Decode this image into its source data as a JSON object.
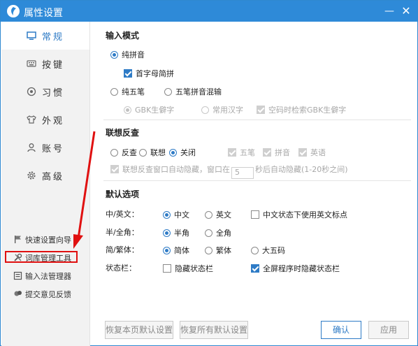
{
  "window": {
    "title": "属性设置",
    "minimize_glyph": "—",
    "close_glyph": "✕"
  },
  "sidebar": {
    "items": [
      {
        "label": "常规",
        "icon": "monitor-icon",
        "active": true
      },
      {
        "label": "按键",
        "icon": "keyboard-icon",
        "active": false
      },
      {
        "label": "习惯",
        "icon": "habit-icon",
        "active": false
      },
      {
        "label": "外观",
        "icon": "shirt-icon",
        "active": false
      },
      {
        "label": "账号",
        "icon": "user-icon",
        "active": false
      },
      {
        "label": "高级",
        "icon": "gear-icon",
        "active": false
      }
    ],
    "tools": [
      {
        "label": "快速设置向导",
        "icon": "flag-icon"
      },
      {
        "label": "词库管理工具",
        "icon": "tools-icon"
      },
      {
        "label": "输入法管理器",
        "icon": "list-icon"
      },
      {
        "label": "提交意见反馈",
        "icon": "feedback-icon"
      }
    ]
  },
  "input_mode": {
    "title": "输入模式",
    "pure_pinyin": "纯拼音",
    "initial_short": "首字母简拼",
    "pure_wubi": "纯五笔",
    "wubi_pinyin": "五笔拼音混输",
    "gbk_rare": "GBK生僻字",
    "common_chars": "常用汉字",
    "space_gbk": "空码时检索GBK生僻字"
  },
  "association": {
    "title": "联想反查",
    "reverse": "反查",
    "associate": "联想",
    "off": "关闭",
    "wubi": "五笔",
    "pinyin": "拼音",
    "english": "英语",
    "auto_hide_prefix": "联想反查窗口自动隐藏，窗口在",
    "auto_hide_value": "5",
    "auto_hide_suffix": "秒后自动隐藏(1-20秒之间)"
  },
  "defaults": {
    "title": "默认选项",
    "cn_en_label": "中/英文：",
    "chinese": "中文",
    "english": "英文",
    "cn_use_en_punct": "中文状态下使用英文标点",
    "width_label": "半/全角：",
    "half": "半角",
    "full": "全角",
    "script_label": "简/繁体：",
    "simplified": "简体",
    "traditional": "繁体",
    "big5": "大五码",
    "status_label": "状态栏：",
    "hide_status": "隐藏状态栏",
    "fullscreen_hide": "全屏程序时隐藏状态栏"
  },
  "buttons": {
    "restore_page": "恢复本页默认设置",
    "restore_all": "恢复所有默认设置",
    "ok": "确认",
    "apply": "应用"
  },
  "colors": {
    "accent": "#2e8ad8",
    "highlight_box": "#e01010",
    "arrow": "#e01010"
  }
}
